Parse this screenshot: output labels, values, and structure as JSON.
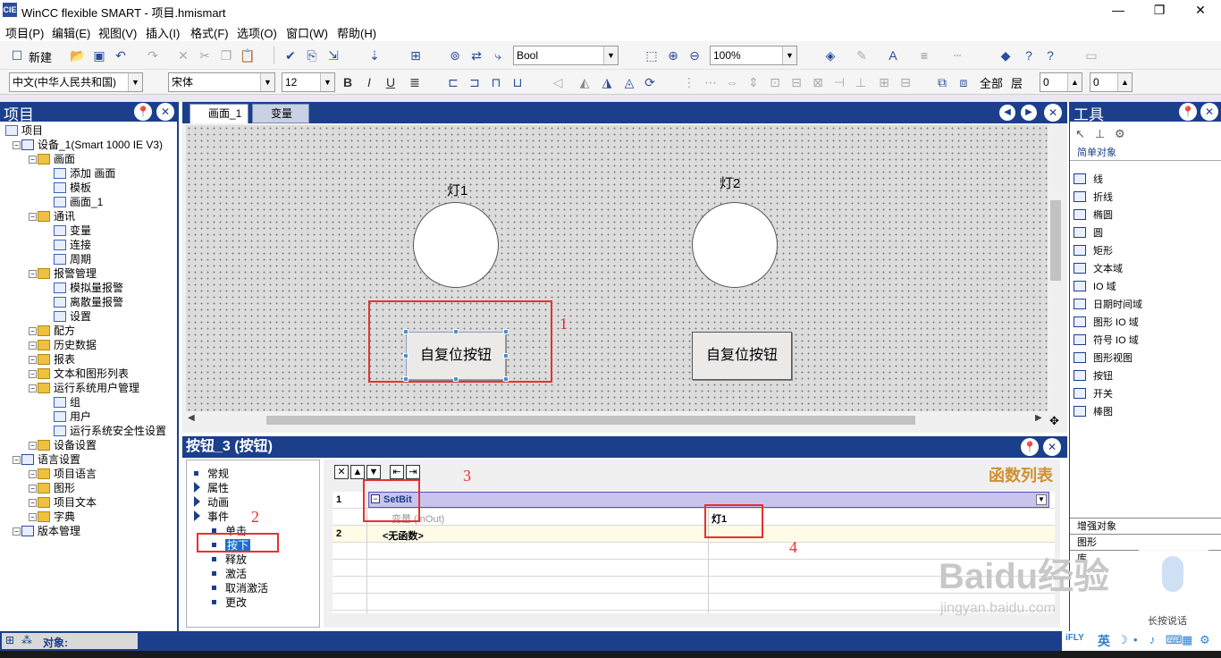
{
  "window": {
    "title": "WinCC flexible SMART - 项目.hmismart",
    "app_icon": "CIE",
    "controls": [
      "—",
      "❐",
      "✕"
    ]
  },
  "menu": [
    "项目(P)",
    "编辑(E)",
    "视图(V)",
    "插入(I)",
    "格式(F)",
    "选项(O)",
    "窗口(W)",
    "帮助(H)"
  ],
  "toolbar": {
    "new_label": "新建",
    "type_combo": "Bool",
    "zoom_combo": "100%",
    "language_combo": "中文(中华人民共和国)",
    "font_combo": "宋体",
    "size_combo": "12",
    "bold": "B",
    "italic": "I",
    "underline": "U",
    "all_label": "全部",
    "layer_label": "层",
    "layer_value1": "0",
    "layer_value2": "0"
  },
  "project_panel": {
    "title": "项目",
    "items": [
      {
        "label": "项目",
        "level": 0
      },
      {
        "label": "设备_1(Smart 1000 IE V3)",
        "level": 1
      },
      {
        "label": "画面",
        "level": 2
      },
      {
        "label": "添加 画面",
        "level": 3
      },
      {
        "label": "模板",
        "level": 3
      },
      {
        "label": "画面_1",
        "level": 3
      },
      {
        "label": "通讯",
        "level": 2
      },
      {
        "label": "变量",
        "level": 3
      },
      {
        "label": "连接",
        "level": 3
      },
      {
        "label": "周期",
        "level": 3
      },
      {
        "label": "报警管理",
        "level": 2
      },
      {
        "label": "模拟量报警",
        "level": 3
      },
      {
        "label": "离散量报警",
        "level": 3
      },
      {
        "label": "设置",
        "level": 3
      },
      {
        "label": "配方",
        "level": 2
      },
      {
        "label": "历史数据",
        "level": 2
      },
      {
        "label": "报表",
        "level": 2
      },
      {
        "label": "文本和图形列表",
        "level": 2
      },
      {
        "label": "运行系统用户管理",
        "level": 2
      },
      {
        "label": "组",
        "level": 3
      },
      {
        "label": "用户",
        "level": 3
      },
      {
        "label": "运行系统安全性设置",
        "level": 3
      },
      {
        "label": "设备设置",
        "level": 2
      },
      {
        "label": "语言设置",
        "level": 1
      },
      {
        "label": "项目语言",
        "level": 2
      },
      {
        "label": "图形",
        "level": 2
      },
      {
        "label": "项目文本",
        "level": 2
      },
      {
        "label": "字典",
        "level": 2
      },
      {
        "label": "版本管理",
        "level": 1
      }
    ]
  },
  "tabs": [
    {
      "label": "画面_1"
    },
    {
      "label": "变量"
    }
  ],
  "canvas": {
    "lamp1_label": "灯1",
    "lamp2_label": "灯2",
    "button1_label": "自复位按钮",
    "button2_label": "自复位按钮"
  },
  "annotations": {
    "n1": "1",
    "n2": "2",
    "n3": "3",
    "n4": "4"
  },
  "properties": {
    "title": "按钮_3 (按钮)",
    "nav": [
      {
        "label": "常规",
        "kind": "bullet"
      },
      {
        "label": "属性",
        "kind": "arrow"
      },
      {
        "label": "动画",
        "kind": "arrow"
      },
      {
        "label": "事件",
        "kind": "arrow"
      },
      {
        "label": "单击",
        "kind": "sub"
      },
      {
        "label": "按下",
        "kind": "sub-selected"
      },
      {
        "label": "释放",
        "kind": "sub"
      },
      {
        "label": "激活",
        "kind": "sub"
      },
      {
        "label": "取消激活",
        "kind": "sub"
      },
      {
        "label": "更改",
        "kind": "sub"
      }
    ],
    "function_list_title": "函数列表",
    "rows": [
      {
        "num": "1",
        "func": "SetBit"
      },
      {
        "param": "变量 (InOut)",
        "value": "灯1"
      },
      {
        "num": "2",
        "func": "<无函数>"
      }
    ]
  },
  "tools": {
    "title": "工具",
    "section_simple": "简单对象",
    "items": [
      "线",
      "折线",
      "椭圆",
      "圆",
      "矩形",
      "文本域",
      "IO 域",
      "日期时间域",
      "图形 IO 域",
      "符号 IO 域",
      "图形视图",
      "按钮",
      "开关",
      "棒图"
    ],
    "section_enhanced": "增强对象",
    "section_graphics": "图形",
    "section_library": "库"
  },
  "status": {
    "object_label": "对象:"
  },
  "overlay": {
    "ime": "英",
    "speech": "长按说话",
    "baidu": "Baidu经验",
    "url": "jingyan.baidu.com"
  },
  "colors": {
    "panel_header": "#1b3f8b",
    "highlight_red": "#e83030",
    "selected_row": "#c8c4ec"
  }
}
